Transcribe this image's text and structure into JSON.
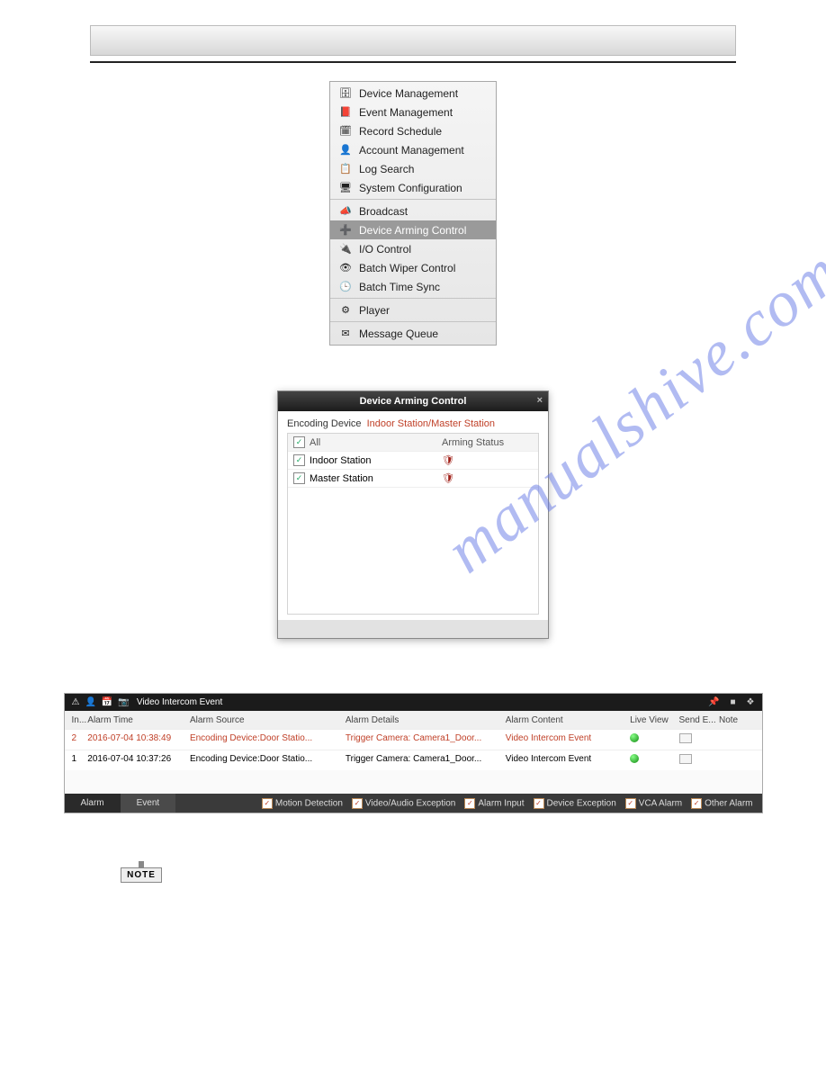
{
  "watermark": "manualshive.com",
  "menu": {
    "groups": [
      [
        {
          "icon": "device-icon",
          "glyph": "🗄",
          "label": "Device Management"
        },
        {
          "icon": "event-icon",
          "glyph": "📕",
          "label": "Event Management"
        },
        {
          "icon": "schedule-icon",
          "glyph": "🗓",
          "label": "Record Schedule"
        },
        {
          "icon": "account-icon",
          "glyph": "👤",
          "label": "Account Management"
        },
        {
          "icon": "log-icon",
          "glyph": "📋",
          "label": "Log Search"
        },
        {
          "icon": "config-icon",
          "glyph": "🖥",
          "label": "System Configuration"
        }
      ],
      [
        {
          "icon": "broadcast-icon",
          "glyph": "📣",
          "label": "Broadcast"
        },
        {
          "icon": "arming-icon",
          "glyph": "➕",
          "label": "Device Arming Control",
          "selected": true
        },
        {
          "icon": "io-icon",
          "glyph": "🔌",
          "label": "I/O Control"
        },
        {
          "icon": "wiper-icon",
          "glyph": "👁",
          "label": "Batch Wiper Control"
        },
        {
          "icon": "time-icon",
          "glyph": "🕒",
          "label": "Batch Time Sync"
        }
      ],
      [
        {
          "icon": "player-icon",
          "glyph": "⚙",
          "label": "Player"
        }
      ],
      [
        {
          "icon": "queue-icon",
          "glyph": "✉",
          "label": "Message Queue"
        }
      ]
    ]
  },
  "dialog": {
    "title": "Device Arming Control",
    "tab1": "Encoding Device",
    "tab2": "Indoor Station/Master Station",
    "col_device": "All",
    "col_status": "Arming Status",
    "rows": [
      {
        "name": "Indoor Station",
        "status_icon": "armed-icon",
        "glyph": "🛡"
      },
      {
        "name": "Master Station",
        "status_icon": "armed-icon",
        "glyph": "🛡"
      }
    ]
  },
  "eventPanel": {
    "title": "Video Intercom Event",
    "pin": "📌",
    "sq": "■",
    "chev": "❖",
    "headers": {
      "idx": "In...",
      "time": "Alarm Time",
      "src": "Alarm Source",
      "det": "Alarm Details",
      "cont": "Alarm Content",
      "live": "Live View",
      "send": "Send E...",
      "note": "Note"
    },
    "rows": [
      {
        "idx": "2",
        "time": "2016-07-04 10:38:49",
        "src": "Encoding Device:Door Statio...",
        "det": "Trigger Camera: Camera1_Door...",
        "cont": "Video Intercom Event",
        "hl": true
      },
      {
        "idx": "1",
        "time": "2016-07-04 10:37:26",
        "src": "Encoding Device:Door Statio...",
        "det": "Trigger Camera: Camera1_Door...",
        "cont": "Video Intercom Event",
        "hl": false
      }
    ],
    "btn_alarm": "Alarm",
    "btn_event": "Event",
    "filters": [
      "Motion Detection",
      "Video/Audio Exception",
      "Alarm Input",
      "Device Exception",
      "VCA Alarm",
      "Other Alarm"
    ]
  },
  "note": "NOTE"
}
